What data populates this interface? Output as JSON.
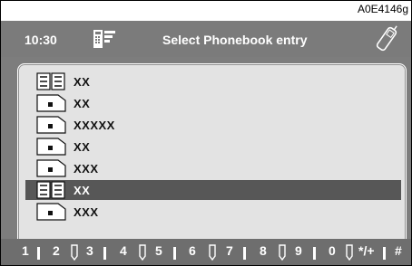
{
  "ref_code": "A0E4146g",
  "header": {
    "time": "10:30",
    "title": "Select Phonebook entry",
    "phonebook_icon": "phonebook-icon",
    "phone_icon": "mobile-phone-icon"
  },
  "entries": [
    {
      "label": "XX",
      "icon": "book-icon",
      "selected": false
    },
    {
      "label": "XX",
      "icon": "card-icon",
      "selected": false
    },
    {
      "label": "XXXXX",
      "icon": "card-icon",
      "selected": false
    },
    {
      "label": "XX",
      "icon": "card-icon",
      "selected": false
    },
    {
      "label": "XXX",
      "icon": "card-icon",
      "selected": false
    },
    {
      "label": "XX",
      "icon": "book-icon",
      "selected": true
    },
    {
      "label": "XXX",
      "icon": "card-icon",
      "selected": false
    }
  ],
  "keypad": {
    "keys": [
      "1",
      "2",
      "3",
      "4",
      "5",
      "6",
      "7",
      "8",
      "9",
      "0",
      "*/+",
      "#"
    ]
  },
  "colors": {
    "screen_bg": "#7d7d7d",
    "list_bg": "#e3e3e3",
    "selection": "#575757"
  }
}
